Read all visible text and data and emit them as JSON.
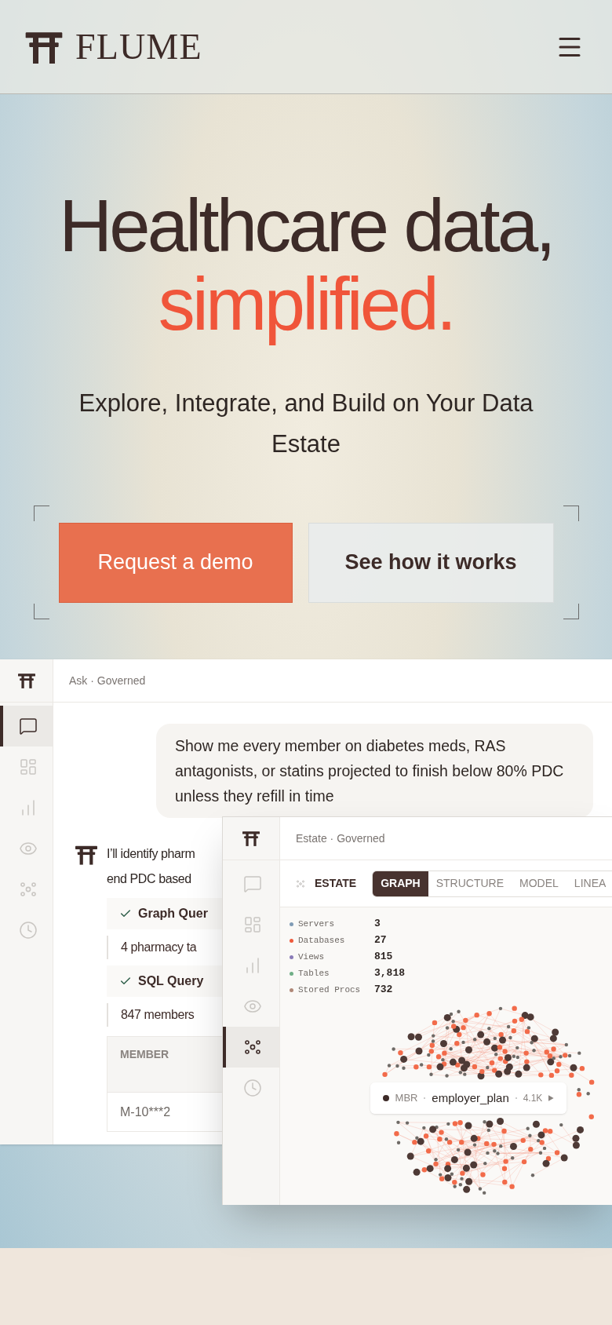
{
  "header": {
    "brand": "FLUME"
  },
  "hero": {
    "title_line1": "Healthcare data,",
    "title_line2": "simplified.",
    "subtitle": "Explore, Integrate, and Build on Your Data Estate",
    "buttons": [
      {
        "label": "Request a demo",
        "kind": "primary"
      },
      {
        "label": "See how it works",
        "kind": "secondary"
      }
    ]
  },
  "ask_panel": {
    "title": "Ask · Governed",
    "nav": [
      {
        "kind": "chat",
        "selected": true
      },
      {
        "kind": "grid",
        "selected": false
      },
      {
        "kind": "bars",
        "selected": false
      },
      {
        "kind": "eye",
        "selected": false
      },
      {
        "kind": "nodes",
        "selected": false
      },
      {
        "kind": "clock",
        "selected": false
      }
    ],
    "user_message": "Show me every member on diabetes meds, RAS antagonists, or statins projected to finish below 80% PDC unless they refill in time",
    "answer_lines": [
      "I’ll identify pharm",
      "end PDC based"
    ],
    "steps": [
      {
        "title": "Graph Quer",
        "result": "4 pharmacy ta"
      },
      {
        "title": "SQL Query",
        "result": "847 members"
      }
    ],
    "table": {
      "columns": [
        "MEMBER"
      ],
      "rows": [
        [
          "M-10***2"
        ]
      ]
    }
  },
  "estate_panel": {
    "title": "Estate · Governed",
    "nav": [
      {
        "kind": "chat",
        "selected": false
      },
      {
        "kind": "grid",
        "selected": false
      },
      {
        "kind": "bars",
        "selected": false
      },
      {
        "kind": "eye",
        "selected": false
      },
      {
        "kind": "nodes",
        "selected": true
      },
      {
        "kind": "clock",
        "selected": false
      }
    ],
    "section": "ESTATE",
    "tabs": [
      {
        "label": "GRAPH",
        "selected": true
      },
      {
        "label": "STRUCTURE",
        "selected": false
      },
      {
        "label": "MODEL",
        "selected": false
      },
      {
        "label": "LINEA",
        "selected": false
      }
    ],
    "stats": [
      {
        "label": "Servers",
        "value": "3",
        "color": "#7f9bb5"
      },
      {
        "label": "Databases",
        "value": "27",
        "color": "#ef5a3c"
      },
      {
        "label": "Views",
        "value": "815",
        "color": "#8a7bb8"
      },
      {
        "label": "Tables",
        "value": "3,818",
        "color": "#6fae86"
      },
      {
        "label": "Stored Procs",
        "value": "732",
        "color": "#b08878"
      }
    ],
    "tooltip": {
      "type": "MBR",
      "name": "employer_plan",
      "count": "4.1K"
    }
  }
}
